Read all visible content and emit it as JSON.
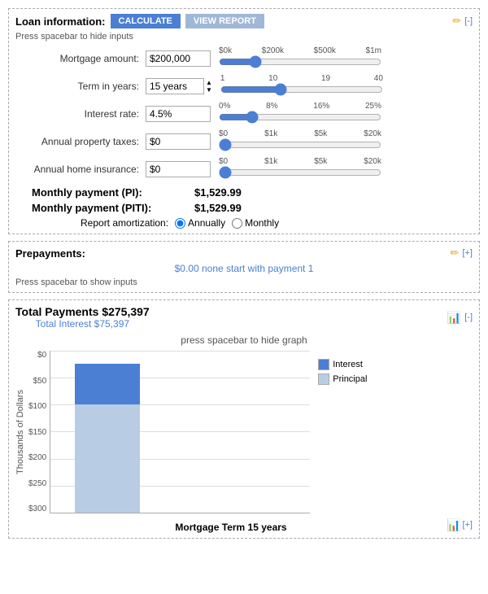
{
  "loan_section": {
    "title": "Loan information:",
    "btn_calculate": "CALCULATE",
    "btn_view_report": "VIEW REPORT",
    "bracket_label": "[-]",
    "press_spacebar": "Press spacebar to hide inputs",
    "fields": {
      "mortgage_amount": {
        "label": "Mortgage amount:",
        "value": "$200,000"
      },
      "term_in_years": {
        "label": "Term in years:",
        "value": "15 years"
      },
      "interest_rate": {
        "label": "Interest rate:",
        "value": "4.5%"
      },
      "annual_property_taxes": {
        "label": "Annual property taxes:",
        "value": "$0"
      },
      "annual_home_insurance": {
        "label": "Annual home insurance:",
        "value": "$0"
      }
    },
    "sliders": {
      "mortgage": {
        "ticks": [
          "$0k",
          "$200k",
          "$500k",
          "$1m"
        ],
        "value": 200
      },
      "term": {
        "ticks": [
          "1",
          "10",
          "19",
          "40"
        ],
        "value": 15
      },
      "interest": {
        "ticks": [
          "0%",
          "8%",
          "16%",
          "25%"
        ],
        "value": 4.5
      },
      "taxes": {
        "ticks": [
          "$0",
          "$1k",
          "$5k",
          "$20k"
        ],
        "value": 0
      },
      "insurance": {
        "ticks": [
          "$0",
          "$1k",
          "$5k",
          "$20k"
        ],
        "value": 0
      }
    },
    "monthly_pi_label": "Monthly payment (PI):",
    "monthly_pi_value": "$1,529.99",
    "monthly_piti_label": "Monthly payment (PITI):",
    "monthly_piti_value": "$1,529.99",
    "amortization_label": "Report amortization:",
    "amortization_options": [
      "Annually",
      "Monthly"
    ],
    "amortization_selected": "Annually"
  },
  "prepayments_section": {
    "title": "Prepayments:",
    "bracket_label": "[+]",
    "info_text": "$0.00 none start with payment 1",
    "press_show": "Press spacebar to show inputs"
  },
  "totals_section": {
    "total_payments_label": "Total Payments $275,397",
    "total_interest_label": "Total Interest $75,397",
    "graph_title": "press spacebar to hide graph",
    "bracket_label": "[-]",
    "x_axis_label": "Mortgage Term 15 years",
    "y_axis_label": "Thousands of Dollars",
    "y_labels": [
      "$0",
      "$50",
      "$100",
      "$150",
      "$200",
      "$250",
      "$300"
    ],
    "legend": [
      {
        "label": "Interest",
        "color": "#4a7fd4"
      },
      {
        "label": "Principal",
        "color": "#b8cce4"
      }
    ],
    "chart": {
      "total_height": 200,
      "interest_pct": 27,
      "principal_pct": 73
    }
  }
}
